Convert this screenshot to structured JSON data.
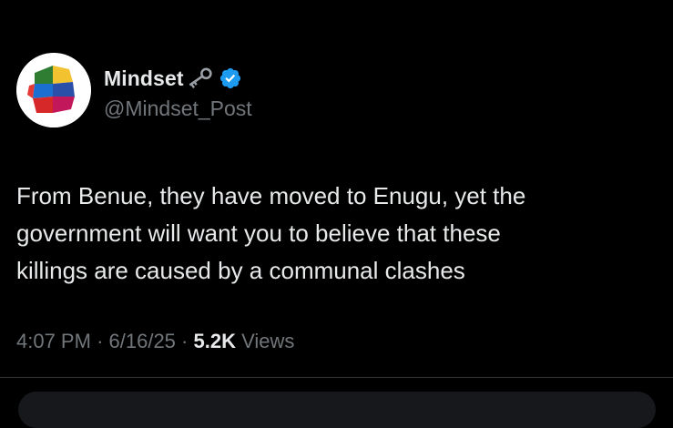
{
  "author": {
    "display_name": "Mindset",
    "handle": "@Mindset_Post",
    "verified": true,
    "name_emoji_icon": "key-icon",
    "avatar_icon": "head-silhouette-logo"
  },
  "tweet": {
    "text": "From Benue, they have moved to Enugu, yet the\ngovernment will want you to believe that these\nkillings are caused by a communal clashes"
  },
  "meta": {
    "time": "4:07 PM",
    "separator": "·",
    "date": "6/16/25",
    "views_count": "5.2K",
    "views_label": "Views"
  },
  "colors": {
    "background": "#000000",
    "text_primary": "#e7e9ea",
    "text_secondary": "#71767b",
    "verified_blue": "#1d9bf0",
    "divider": "#2f3336"
  }
}
